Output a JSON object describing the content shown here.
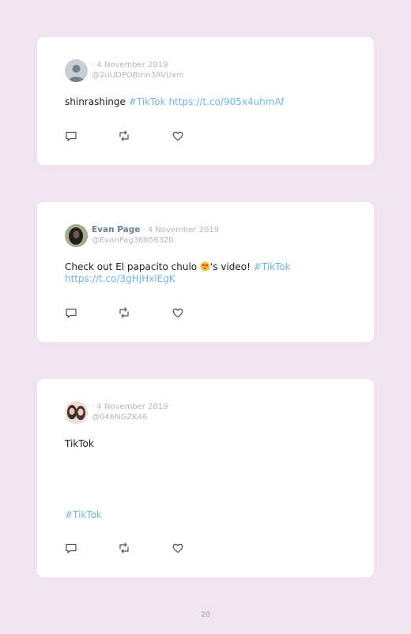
{
  "tweets": [
    {
      "name": "",
      "date": "· 4 November 2019",
      "handle": "@2uUDPOBmn3AVUxm",
      "text_plain": "shinrashinge",
      "hashtag": "#TikTok",
      "link": "https://t.co/905x4uhmAf",
      "avatar": "default-person-avatar"
    },
    {
      "name": "Evan Page",
      "date": "· 4 November 2019",
      "handle": "@EvanPag36656320",
      "text_before_emoji": "Check out El papacito chulo",
      "emoji": "heart-eyes-emoji",
      "text_after_emoji": "'s video!",
      "hashtag": "#TikTok",
      "link": "https://t.co/3gHjHxlEgK",
      "avatar": "photo-avatar"
    },
    {
      "name": "",
      "date": "· 4 November 2019",
      "handle": "@046NGZK46",
      "text_plain": "TikTok",
      "hashtag": "#TikTok",
      "avatar": "photo-avatar"
    }
  ],
  "icons": [
    "reply-icon",
    "retweet-icon",
    "like-icon"
  ],
  "page_number": "20",
  "colors": {
    "background": "#f1e4ee",
    "card": "#ffffff",
    "link": "#6cb9e4",
    "meta": "#b2b8bf",
    "name": "#6d7f90",
    "icon": "#4a4f55"
  }
}
